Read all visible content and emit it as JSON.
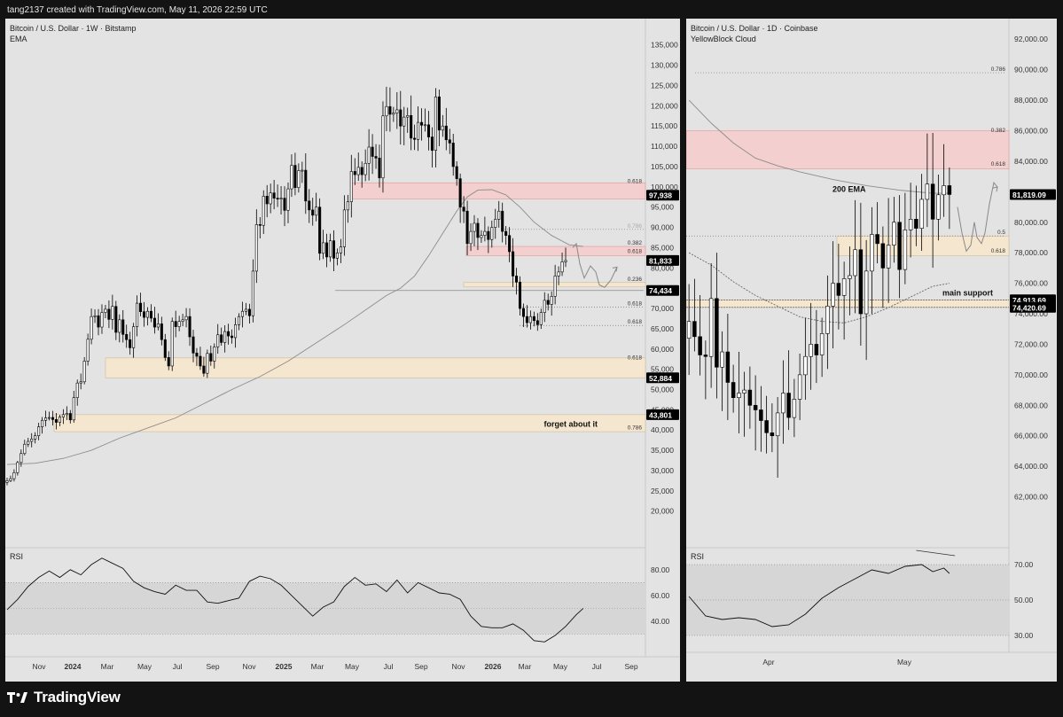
{
  "header": {
    "text": "tang2137 created with TradingView.com, May 11, 2026 22:59 UTC"
  },
  "brand": {
    "name": "TradingView"
  },
  "colors": {
    "bull": "#ffffff",
    "bear": "#000000",
    "wick": "#000000",
    "ema": "#8c8c8c",
    "pink_zone": "#f3cfcf",
    "beige_zone": "#f5e6cf",
    "pane_bg": "#e3e3e3",
    "axis_text": "#333333",
    "price_tag_bg": "#000000",
    "price_tag_text": "#ffffff"
  },
  "left": {
    "title": "Bitcoin / U.S. Dollar · 1W · Bitstamp",
    "subtitle": "EMA",
    "rsi_label": "RSI",
    "chart_data": {
      "type": "candlestick",
      "x_ticks": [
        "Nov",
        "2024",
        "Mar",
        "May",
        "Jul",
        "Sep",
        "Nov",
        "2025",
        "Mar",
        "May",
        "Jul",
        "Sep",
        "Nov",
        "2026",
        "Mar",
        "May",
        "Jul",
        "Sep"
      ],
      "y_ticks": [
        "135,000",
        "130,000",
        "125,000",
        "120,000",
        "115,000",
        "110,000",
        "105,000",
        "100,000",
        "95,000",
        "90,000",
        "85,000",
        "80,000",
        "75,000",
        "70,000",
        "65,000",
        "60,000",
        "55,000",
        "50,000",
        "45,000",
        "40,000",
        "35,000",
        "30,000",
        "25,000",
        "20,000"
      ],
      "ylim": [
        16000,
        138000
      ],
      "price_tags": [
        "97,938",
        "81,833",
        "74,434",
        "52,884",
        "43,801"
      ],
      "fib_labels": [
        {
          "text": "0.618",
          "value": 100500
        },
        {
          "text": "0.786",
          "value": 89500
        },
        {
          "text": "0.382",
          "value": 85300
        },
        {
          "text": "0.618",
          "value": 83200
        },
        {
          "text": "0.236",
          "value": 76300
        },
        {
          "text": "0.618",
          "value": 70300
        },
        {
          "text": "0.618",
          "value": 65800
        },
        {
          "text": "0.618",
          "value": 57000
        },
        {
          "text": "0.786",
          "value": 39700
        }
      ],
      "annotations": [
        "forget about it"
      ],
      "rsi_ticks": [
        "80.00",
        "60.00",
        "40.00"
      ],
      "rsi_ylim": [
        18,
        95
      ],
      "rsi_levels": [
        70,
        30,
        50
      ],
      "closes": [
        27500,
        28000,
        29500,
        32000,
        34200,
        36500,
        37200,
        37800,
        38600,
        40800,
        42400,
        43000,
        43100,
        42600,
        41900,
        43200,
        43800,
        44100,
        42500,
        48000,
        51600,
        51900,
        57000,
        62400,
        68000,
        68200,
        65400,
        69000,
        69800,
        67300,
        70500,
        64100,
        67200,
        63600,
        62300,
        60300,
        65500,
        71300,
        69200,
        67800,
        69300,
        67600,
        65400,
        66200,
        62300,
        57900,
        55800,
        66800,
        65500,
        66800,
        67200,
        68000,
        63000,
        59000,
        58200,
        55800,
        54000,
        58900,
        57000,
        60500,
        63500,
        61600,
        64300,
        63200,
        62800,
        66000,
        68000,
        69300,
        69800,
        68200,
        79200,
        90700,
        90500,
        97700,
        95800,
        98500,
        97200,
        97000,
        97200,
        94200,
        99500,
        105300,
        99800,
        104000,
        104100,
        96500,
        94300,
        93000,
        95000,
        83600,
        86200,
        82700,
        86700,
        82400,
        83700,
        85200,
        94300,
        96300,
        103800,
        103000,
        104800,
        103000,
        105800,
        109800,
        107500,
        107100,
        102200,
        117500,
        119800,
        117900,
        118200,
        119000,
        115000,
        117200,
        117600,
        112000,
        111700,
        115900,
        115200,
        115300,
        112300,
        109000,
        122200,
        114000,
        115000,
        111600,
        110800,
        105000,
        102000,
        95000,
        94000,
        86000,
        89000,
        91000,
        87500,
        88000,
        89000,
        87000,
        90000,
        92000,
        94000,
        89000,
        88000,
        84000,
        78000,
        76500,
        70000,
        68000,
        66500,
        68000,
        67000,
        66000,
        69000,
        72000,
        71000,
        73000,
        78000,
        79000,
        81500,
        81833
      ],
      "ema_path": [
        [
          0,
          31500
        ],
        [
          8,
          31800
        ],
        [
          16,
          33000
        ],
        [
          24,
          35000
        ],
        [
          32,
          38000
        ],
        [
          40,
          40500
        ],
        [
          48,
          43000
        ],
        [
          56,
          46500
        ],
        [
          64,
          50000
        ],
        [
          72,
          53200
        ],
        [
          80,
          57000
        ],
        [
          88,
          61500
        ],
        [
          96,
          66000
        ],
        [
          104,
          70800
        ],
        [
          108,
          73200
        ],
        [
          112,
          75000
        ],
        [
          116,
          78000
        ],
        [
          120,
          83000
        ],
        [
          124,
          88500
        ],
        [
          128,
          94000
        ],
        [
          131,
          97500
        ],
        [
          134,
          99200
        ],
        [
          138,
          99300
        ],
        [
          142,
          98000
        ],
        [
          146,
          95000
        ],
        [
          150,
          91300
        ],
        [
          155,
          88000
        ],
        [
          160,
          85700
        ],
        [
          164,
          85300
        ]
      ],
      "rsi_points": [
        [
          0,
          49
        ],
        [
          3,
          57
        ],
        [
          6,
          67
        ],
        [
          9,
          74
        ],
        [
          12,
          79
        ],
        [
          15,
          74
        ],
        [
          18,
          80
        ],
        [
          21,
          76
        ],
        [
          24,
          84
        ],
        [
          27,
          89
        ],
        [
          30,
          85
        ],
        [
          33,
          81
        ],
        [
          36,
          71
        ],
        [
          39,
          66
        ],
        [
          42,
          63
        ],
        [
          45,
          61
        ],
        [
          48,
          68
        ],
        [
          51,
          64
        ],
        [
          54,
          64
        ],
        [
          57,
          55
        ],
        [
          60,
          54
        ],
        [
          63,
          56
        ],
        [
          66,
          58
        ],
        [
          69,
          71
        ],
        [
          72,
          75
        ],
        [
          75,
          73
        ],
        [
          78,
          68
        ],
        [
          81,
          60
        ],
        [
          84,
          52
        ],
        [
          87,
          44
        ],
        [
          90,
          51
        ],
        [
          93,
          55
        ],
        [
          96,
          67
        ],
        [
          99,
          74
        ],
        [
          102,
          68
        ],
        [
          105,
          69
        ],
        [
          108,
          63
        ],
        [
          111,
          72
        ],
        [
          114,
          62
        ],
        [
          117,
          70
        ],
        [
          120,
          66
        ],
        [
          123,
          62
        ],
        [
          126,
          61
        ],
        [
          129,
          57
        ],
        [
          132,
          44
        ],
        [
          135,
          36
        ],
        [
          138,
          35
        ],
        [
          141,
          35
        ],
        [
          144,
          38
        ],
        [
          147,
          33
        ],
        [
          150,
          25
        ],
        [
          153,
          24
        ],
        [
          156,
          29
        ],
        [
          159,
          36
        ],
        [
          162,
          45
        ],
        [
          164,
          50
        ]
      ]
    }
  },
  "right": {
    "title": "Bitcoin / U.S. Dollar · 1D · Coinbase",
    "subtitle": "YellowBlock Cloud",
    "rsi_label": "RSI",
    "chart_data": {
      "type": "candlestick",
      "x_ticks": [
        "Apr",
        "May"
      ],
      "y_ticks": [
        "92,000.00",
        "90,000.00",
        "88,000.00",
        "86,000.00",
        "84,000.00",
        "82,000.00",
        "80,000.00",
        "78,000.00",
        "76,000.00",
        "74,000.00",
        "72,000.00",
        "70,000.00",
        "68,000.00",
        "66,000.00",
        "64,000.00",
        "62,000.00"
      ],
      "ylim": [
        60000,
        93000
      ],
      "price_tags": [
        "81,819.09",
        "74,913.69",
        "74,420.69"
      ],
      "fib_labels": [
        {
          "text": "0.786",
          "value": 89800
        },
        {
          "text": "0.382",
          "value": 85800
        },
        {
          "text": "0.618",
          "value": 83600
        },
        {
          "text": "0.5",
          "value": 79100
        },
        {
          "text": "0.618",
          "value": 77900
        }
      ],
      "annotations": [
        "200 EMA",
        "main support"
      ],
      "rsi_ticks": [
        "70.00",
        "50.00",
        "30.00"
      ],
      "rsi_ylim": [
        22,
        78
      ],
      "rsi_levels": [
        70,
        30,
        50
      ],
      "closes": [
        73500,
        72500,
        71300,
        71200,
        75000,
        70500,
        71500,
        69500,
        68500,
        68800,
        69000,
        68000,
        67700,
        67000,
        66200,
        66000,
        67500,
        68800,
        67200,
        68400,
        70000,
        71200,
        72000,
        71300,
        72700,
        74500,
        76000,
        75200,
        76300,
        76500,
        78200,
        74000,
        76800,
        79200,
        78600,
        77000,
        78500,
        80000,
        76900,
        79500,
        80200,
        79600,
        81500,
        82500,
        80200,
        81800,
        82400,
        81819
      ],
      "ema_path": [
        [
          0,
          88000
        ],
        [
          4,
          86500
        ],
        [
          8,
          85200
        ],
        [
          12,
          84200
        ],
        [
          16,
          83700
        ],
        [
          20,
          83300
        ],
        [
          26,
          82800
        ],
        [
          32,
          82400
        ],
        [
          38,
          82100
        ],
        [
          44,
          81900
        ],
        [
          47,
          81900
        ]
      ],
      "cloud_path": [
        [
          0,
          78000
        ],
        [
          4,
          77200
        ],
        [
          8,
          76100
        ],
        [
          12,
          75200
        ],
        [
          16,
          74500
        ],
        [
          20,
          73800
        ],
        [
          24,
          73500
        ],
        [
          28,
          73400
        ],
        [
          32,
          73800
        ],
        [
          36,
          74400
        ],
        [
          40,
          75100
        ],
        [
          44,
          75800
        ],
        [
          47,
          76000
        ]
      ],
      "rsi_points": [
        [
          0,
          52
        ],
        [
          3,
          41
        ],
        [
          6,
          39
        ],
        [
          9,
          40
        ],
        [
          12,
          39
        ],
        [
          15,
          35
        ],
        [
          18,
          36
        ],
        [
          21,
          42
        ],
        [
          24,
          51
        ],
        [
          27,
          57
        ],
        [
          30,
          62
        ],
        [
          33,
          67
        ],
        [
          36,
          65
        ],
        [
          39,
          69
        ],
        [
          42,
          70
        ],
        [
          44,
          66
        ],
        [
          46,
          68
        ],
        [
          47,
          65
        ]
      ]
    }
  }
}
